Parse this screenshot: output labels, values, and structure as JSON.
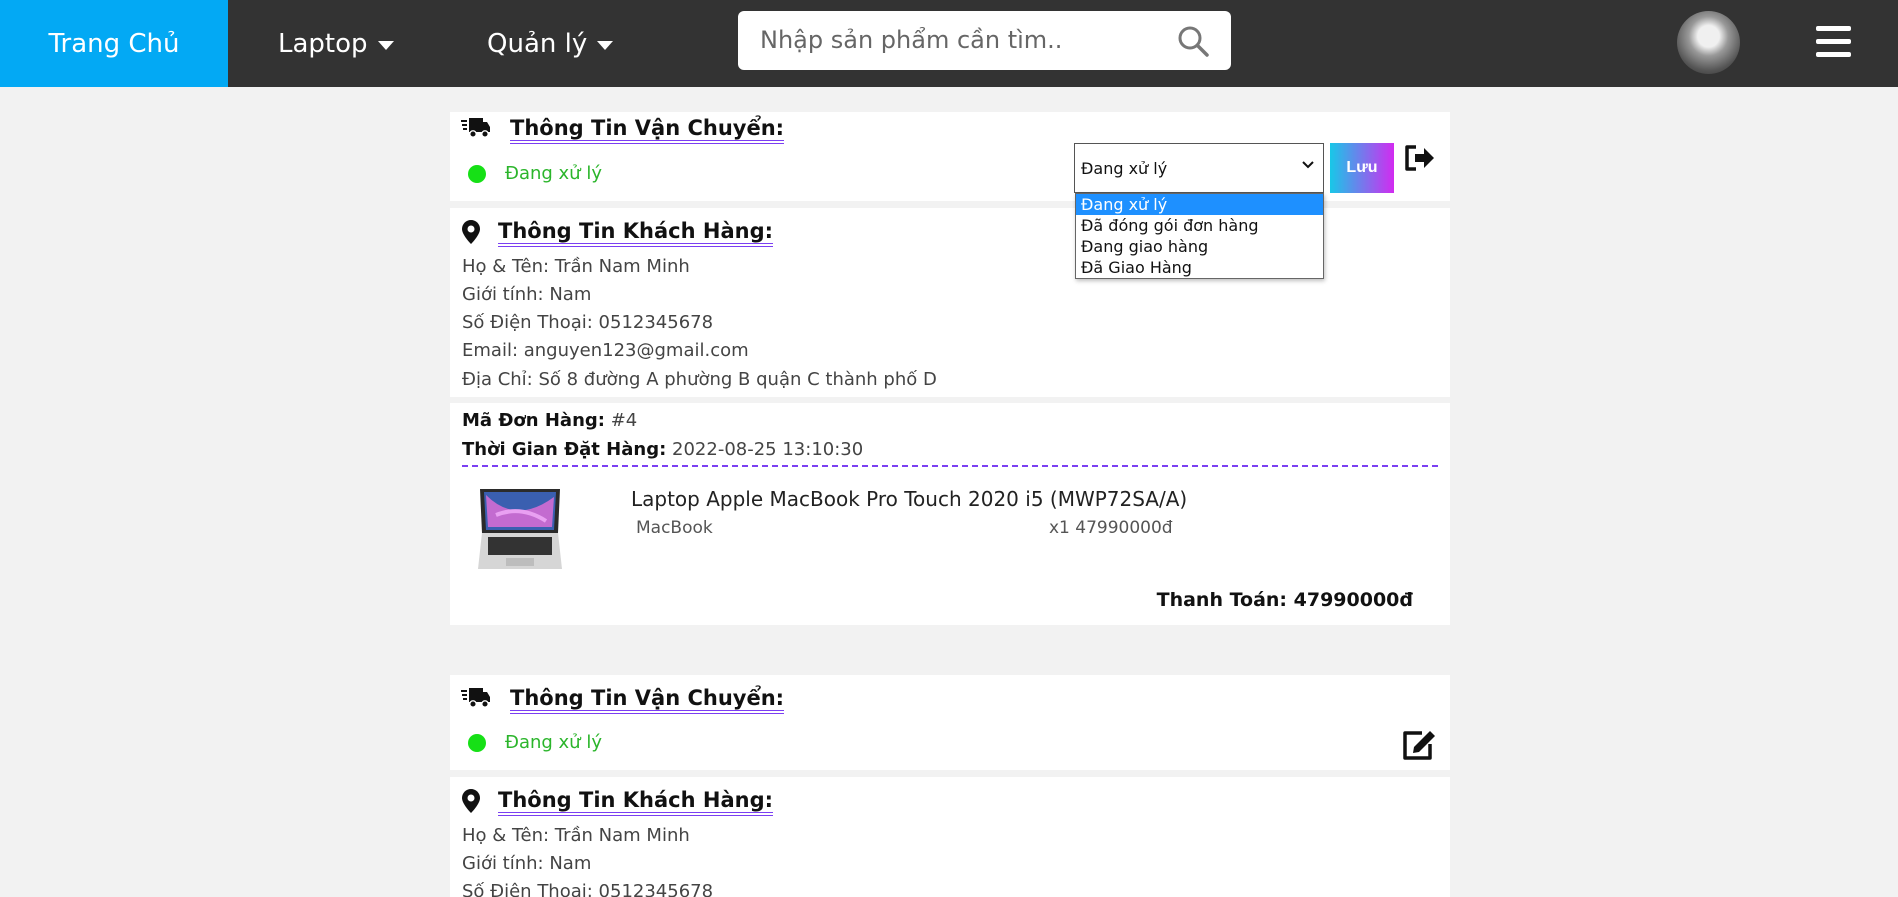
{
  "nav": {
    "home": "Trang Chủ",
    "laptop": "Laptop",
    "manage": "Quản lý",
    "search_placeholder": "Nhập sản phẩm cần tìm.."
  },
  "orders": [
    {
      "shipping_title": "Thông Tin Vận Chuyển:",
      "status": "Đang xử lý",
      "select_value": "Đang xử lý",
      "status_options": [
        "Đang xử lý",
        "Đã đóng gói đơn hàng",
        "Đang giao hàng",
        "Đã Giao Hàng"
      ],
      "save_label": "Lưu",
      "customer_title": "Thông Tin Khách Hàng:",
      "name": "Họ & Tên: Trần Nam Minh",
      "gender": "Giới tính: Nam",
      "phone": "Số Điện Thoại: 0512345678",
      "email": "Email: anguyen123@gmail.com",
      "address": "Địa Chỉ: Số 8 đường A phường B quận C thành phố D",
      "order_code_label": "Mã Đơn Hàng:",
      "order_code": "#4",
      "order_time_label": "Thời Gian Đặt Hàng:",
      "order_time": "2022-08-25 13:10:30",
      "product_name": "Laptop Apple MacBook Pro Touch 2020 i5 (MWP72SA/A)",
      "product_category": "MacBook",
      "product_qty_price": "x1 47990000đ",
      "total": "Thanh Toán: 47990000đ"
    },
    {
      "shipping_title": "Thông Tin Vận Chuyển:",
      "status": "Đang xử lý",
      "customer_title": "Thông Tin Khách Hàng:",
      "name": "Họ & Tên: Trần Nam Minh",
      "gender": "Giới tính: Nam",
      "phone": "Số Điện Thoại: 0512345678"
    }
  ],
  "icons": {
    "search": "search-icon",
    "truck": "truck-icon",
    "location": "map-marker-icon",
    "exit": "sign-out-icon",
    "edit": "edit-icon",
    "menu": "hamburger-menu-icon"
  },
  "colors": {
    "nav_bg": "#333333",
    "home_active": "#03a9f4",
    "status_green": "#16e016",
    "title_underline": "#7b3ff2"
  }
}
